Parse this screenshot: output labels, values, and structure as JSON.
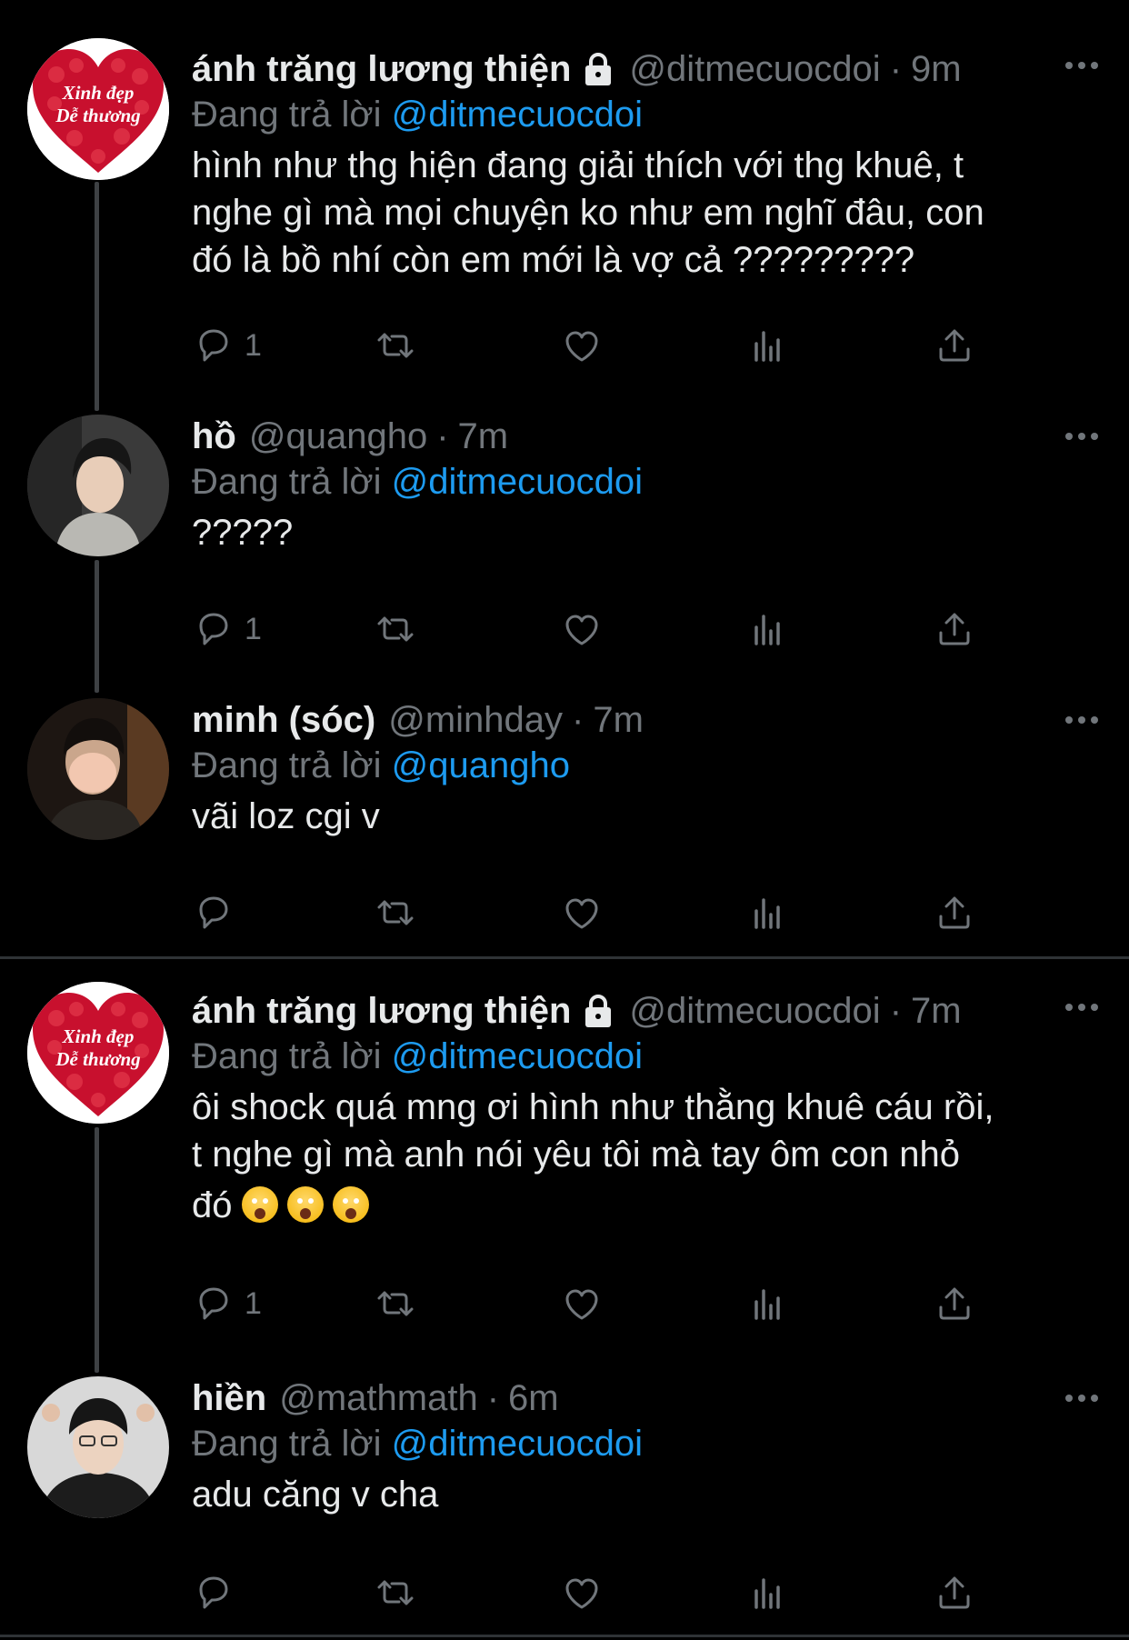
{
  "tweets": [
    {
      "name": "ánh trăng lương thiện",
      "handle": "@ditmecuocdoi",
      "time": "9m",
      "reply_prefix": "Đang trả lời",
      "reply_to": "@ditmecuocdoi",
      "text_lines": [
        "hình như thg hiện đang giải thích với thg khuê, t",
        "nghe gì mà mọi chuyện ko như em nghĩ đâu, con",
        "đó là bồ nhí còn em mới là vợ cả ?????????"
      ],
      "reply_count": "1",
      "avatar_text": [
        "Xinh đẹp",
        "Dễ thương"
      ]
    },
    {
      "name": "hồ",
      "handle": "@quangho",
      "time": "7m",
      "reply_prefix": "Đang trả lời",
      "reply_to": "@ditmecuocdoi",
      "text_lines": [
        "?????"
      ],
      "reply_count": "1"
    },
    {
      "name": "minh (sóc)",
      "handle": "@minhday",
      "time": "7m",
      "reply_prefix": "Đang trả lời",
      "reply_to": "@quangho",
      "text_lines": [
        "vãi loz cgi v"
      ],
      "reply_count": ""
    },
    {
      "name": "ánh trăng lương thiện",
      "handle": "@ditmecuocdoi",
      "time": "7m",
      "reply_prefix": "Đang trả lời",
      "reply_to": "@ditmecuocdoi",
      "text_lines": [
        "ôi shock quá mng ơi hình như thằng khuê cáu rồi,",
        "t nghe gì mà anh nói yêu tôi mà tay ôm con nhỏ",
        "đó"
      ],
      "reply_count": "1",
      "avatar_text": [
        "Xinh đẹp",
        "Dễ thương"
      ]
    },
    {
      "name": "hiền",
      "handle": "@mathmath",
      "time": "6m",
      "reply_prefix": "Đang trả lời",
      "reply_to": "@ditmecuocdoi",
      "text_lines": [
        "adu căng v cha"
      ],
      "reply_count": ""
    }
  ],
  "separator": "·",
  "icons": {
    "reply": "reply-icon",
    "retweet": "retweet-icon",
    "like": "heart-icon",
    "views": "analytics-icon",
    "share": "share-icon",
    "lock": "lock-icon",
    "more": "more-icon",
    "emoji": "scream-emoji-icon"
  },
  "colors": {
    "background": "#000000",
    "text": "#e7e9ea",
    "secondary": "#71767b",
    "mention": "#1d9bf0",
    "thread_line": "#3e4144",
    "avatar_heart": "#c8102e"
  }
}
